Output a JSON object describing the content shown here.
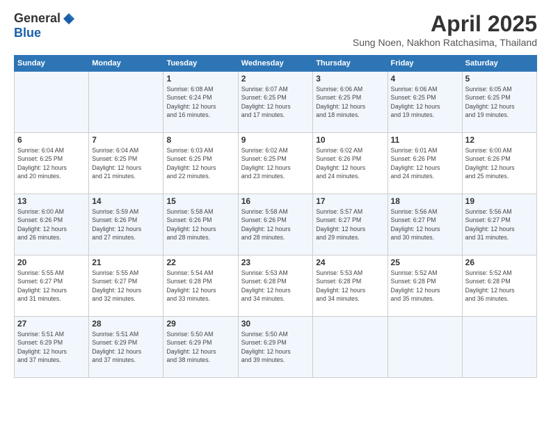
{
  "logo": {
    "general": "General",
    "blue": "Blue"
  },
  "header": {
    "month": "April 2025",
    "location": "Sung Noen, Nakhon Ratchasima, Thailand"
  },
  "weekdays": [
    "Sunday",
    "Monday",
    "Tuesday",
    "Wednesday",
    "Thursday",
    "Friday",
    "Saturday"
  ],
  "weeks": [
    [
      {
        "day": "",
        "sunrise": "",
        "sunset": "",
        "daylight": ""
      },
      {
        "day": "",
        "sunrise": "",
        "sunset": "",
        "daylight": ""
      },
      {
        "day": "1",
        "sunrise": "Sunrise: 6:08 AM",
        "sunset": "Sunset: 6:24 PM",
        "daylight": "Daylight: 12 hours and 16 minutes."
      },
      {
        "day": "2",
        "sunrise": "Sunrise: 6:07 AM",
        "sunset": "Sunset: 6:25 PM",
        "daylight": "Daylight: 12 hours and 17 minutes."
      },
      {
        "day": "3",
        "sunrise": "Sunrise: 6:06 AM",
        "sunset": "Sunset: 6:25 PM",
        "daylight": "Daylight: 12 hours and 18 minutes."
      },
      {
        "day": "4",
        "sunrise": "Sunrise: 6:06 AM",
        "sunset": "Sunset: 6:25 PM",
        "daylight": "Daylight: 12 hours and 19 minutes."
      },
      {
        "day": "5",
        "sunrise": "Sunrise: 6:05 AM",
        "sunset": "Sunset: 6:25 PM",
        "daylight": "Daylight: 12 hours and 19 minutes."
      }
    ],
    [
      {
        "day": "6",
        "sunrise": "Sunrise: 6:04 AM",
        "sunset": "Sunset: 6:25 PM",
        "daylight": "Daylight: 12 hours and 20 minutes."
      },
      {
        "day": "7",
        "sunrise": "Sunrise: 6:04 AM",
        "sunset": "Sunset: 6:25 PM",
        "daylight": "Daylight: 12 hours and 21 minutes."
      },
      {
        "day": "8",
        "sunrise": "Sunrise: 6:03 AM",
        "sunset": "Sunset: 6:25 PM",
        "daylight": "Daylight: 12 hours and 22 minutes."
      },
      {
        "day": "9",
        "sunrise": "Sunrise: 6:02 AM",
        "sunset": "Sunset: 6:25 PM",
        "daylight": "Daylight: 12 hours and 23 minutes."
      },
      {
        "day": "10",
        "sunrise": "Sunrise: 6:02 AM",
        "sunset": "Sunset: 6:26 PM",
        "daylight": "Daylight: 12 hours and 24 minutes."
      },
      {
        "day": "11",
        "sunrise": "Sunrise: 6:01 AM",
        "sunset": "Sunset: 6:26 PM",
        "daylight": "Daylight: 12 hours and 24 minutes."
      },
      {
        "day": "12",
        "sunrise": "Sunrise: 6:00 AM",
        "sunset": "Sunset: 6:26 PM",
        "daylight": "Daylight: 12 hours and 25 minutes."
      }
    ],
    [
      {
        "day": "13",
        "sunrise": "Sunrise: 6:00 AM",
        "sunset": "Sunset: 6:26 PM",
        "daylight": "Daylight: 12 hours and 26 minutes."
      },
      {
        "day": "14",
        "sunrise": "Sunrise: 5:59 AM",
        "sunset": "Sunset: 6:26 PM",
        "daylight": "Daylight: 12 hours and 27 minutes."
      },
      {
        "day": "15",
        "sunrise": "Sunrise: 5:58 AM",
        "sunset": "Sunset: 6:26 PM",
        "daylight": "Daylight: 12 hours and 28 minutes."
      },
      {
        "day": "16",
        "sunrise": "Sunrise: 5:58 AM",
        "sunset": "Sunset: 6:26 PM",
        "daylight": "Daylight: 12 hours and 28 minutes."
      },
      {
        "day": "17",
        "sunrise": "Sunrise: 5:57 AM",
        "sunset": "Sunset: 6:27 PM",
        "daylight": "Daylight: 12 hours and 29 minutes."
      },
      {
        "day": "18",
        "sunrise": "Sunrise: 5:56 AM",
        "sunset": "Sunset: 6:27 PM",
        "daylight": "Daylight: 12 hours and 30 minutes."
      },
      {
        "day": "19",
        "sunrise": "Sunrise: 5:56 AM",
        "sunset": "Sunset: 6:27 PM",
        "daylight": "Daylight: 12 hours and 31 minutes."
      }
    ],
    [
      {
        "day": "20",
        "sunrise": "Sunrise: 5:55 AM",
        "sunset": "Sunset: 6:27 PM",
        "daylight": "Daylight: 12 hours and 31 minutes."
      },
      {
        "day": "21",
        "sunrise": "Sunrise: 5:55 AM",
        "sunset": "Sunset: 6:27 PM",
        "daylight": "Daylight: 12 hours and 32 minutes."
      },
      {
        "day": "22",
        "sunrise": "Sunrise: 5:54 AM",
        "sunset": "Sunset: 6:28 PM",
        "daylight": "Daylight: 12 hours and 33 minutes."
      },
      {
        "day": "23",
        "sunrise": "Sunrise: 5:53 AM",
        "sunset": "Sunset: 6:28 PM",
        "daylight": "Daylight: 12 hours and 34 minutes."
      },
      {
        "day": "24",
        "sunrise": "Sunrise: 5:53 AM",
        "sunset": "Sunset: 6:28 PM",
        "daylight": "Daylight: 12 hours and 34 minutes."
      },
      {
        "day": "25",
        "sunrise": "Sunrise: 5:52 AM",
        "sunset": "Sunset: 6:28 PM",
        "daylight": "Daylight: 12 hours and 35 minutes."
      },
      {
        "day": "26",
        "sunrise": "Sunrise: 5:52 AM",
        "sunset": "Sunset: 6:28 PM",
        "daylight": "Daylight: 12 hours and 36 minutes."
      }
    ],
    [
      {
        "day": "27",
        "sunrise": "Sunrise: 5:51 AM",
        "sunset": "Sunset: 6:29 PM",
        "daylight": "Daylight: 12 hours and 37 minutes."
      },
      {
        "day": "28",
        "sunrise": "Sunrise: 5:51 AM",
        "sunset": "Sunset: 6:29 PM",
        "daylight": "Daylight: 12 hours and 37 minutes."
      },
      {
        "day": "29",
        "sunrise": "Sunrise: 5:50 AM",
        "sunset": "Sunset: 6:29 PM",
        "daylight": "Daylight: 12 hours and 38 minutes."
      },
      {
        "day": "30",
        "sunrise": "Sunrise: 5:50 AM",
        "sunset": "Sunset: 6:29 PM",
        "daylight": "Daylight: 12 hours and 39 minutes."
      },
      {
        "day": "",
        "sunrise": "",
        "sunset": "",
        "daylight": ""
      },
      {
        "day": "",
        "sunrise": "",
        "sunset": "",
        "daylight": ""
      },
      {
        "day": "",
        "sunrise": "",
        "sunset": "",
        "daylight": ""
      }
    ]
  ]
}
